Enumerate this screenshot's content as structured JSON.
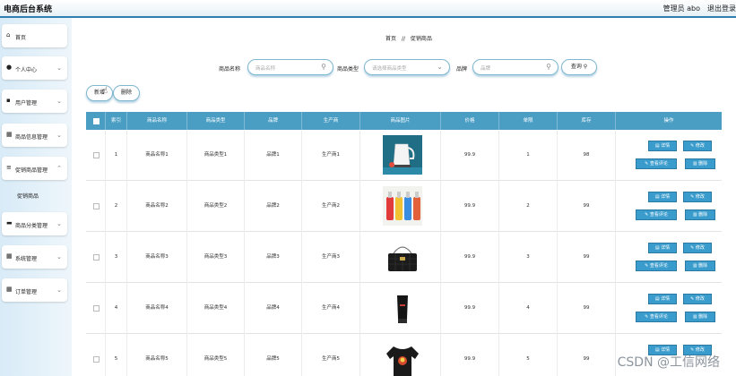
{
  "header": {
    "title": "电商后台系统",
    "user": "管理员 abo",
    "logout": "退出登录"
  },
  "sidebar": {
    "items": [
      {
        "label": "首页",
        "icon": "home-icon",
        "glyph": "⌂"
      },
      {
        "label": "个人中心",
        "icon": "user-icon",
        "glyph": "●"
      },
      {
        "label": "用户管理",
        "icon": "users-icon",
        "glyph": "▪"
      },
      {
        "label": "商品信息管理",
        "icon": "grid-icon",
        "glyph": "▦"
      },
      {
        "label": "促销商品管理",
        "icon": "list-icon",
        "glyph": "≡"
      },
      {
        "label": "商品分类管理",
        "icon": "category-icon",
        "glyph": "▬"
      },
      {
        "label": "系统管理",
        "icon": "grid-icon",
        "glyph": "▦"
      },
      {
        "label": "订单管理",
        "icon": "grid-icon",
        "glyph": "▦"
      }
    ],
    "sub_item": "促销商品"
  },
  "breadcrumb": {
    "home": "首页",
    "sep": "//",
    "current": "促销商品"
  },
  "search": {
    "name_label": "商品名称",
    "name_placeholder": "商品名称",
    "type_label": "商品类型",
    "type_placeholder": "请选择商品类型",
    "brand_label": "品牌",
    "brand_placeholder": "品牌",
    "query_button": "查询"
  },
  "toolbar": {
    "add": "新增",
    "delete": "删除"
  },
  "table": {
    "headers": [
      "索引",
      "商品名称",
      "商品类型",
      "品牌",
      "生产商",
      "商品图片",
      "价格",
      "单限",
      "库存",
      "操作"
    ],
    "rows": [
      {
        "index": "1",
        "name": "商品名称1",
        "type": "商品类型1",
        "brand": "品牌1",
        "maker": "生产商1",
        "price": "99.9",
        "limit": "1",
        "stock": "98",
        "image": "kettle"
      },
      {
        "index": "2",
        "name": "商品名称2",
        "type": "商品类型2",
        "brand": "品牌2",
        "maker": "生产商2",
        "price": "99.9",
        "limit": "2",
        "stock": "99",
        "image": "bottles"
      },
      {
        "index": "3",
        "name": "商品名称3",
        "type": "商品类型3",
        "brand": "品牌3",
        "maker": "生产商3",
        "price": "99.9",
        "limit": "3",
        "stock": "99",
        "image": "handbag"
      },
      {
        "index": "4",
        "name": "商品名称4",
        "type": "商品类型4",
        "brand": "品牌4",
        "maker": "生产商4",
        "price": "99.9",
        "limit": "4",
        "stock": "99",
        "image": "tube"
      },
      {
        "index": "5",
        "name": "商品名称5",
        "type": "商品类型5",
        "brand": "品牌5",
        "maker": "生产商5",
        "price": "99.9",
        "limit": "5",
        "stock": "99",
        "image": "sweater"
      }
    ],
    "actions": {
      "detail": "详情",
      "edit": "修改",
      "review": "查看评论",
      "delete": "删除"
    }
  },
  "watermark": "CSDN @工信网络",
  "colors": {
    "accent": "#4a9ec4",
    "button": "#3a9ccc",
    "header_border": "#2f7fb0"
  }
}
